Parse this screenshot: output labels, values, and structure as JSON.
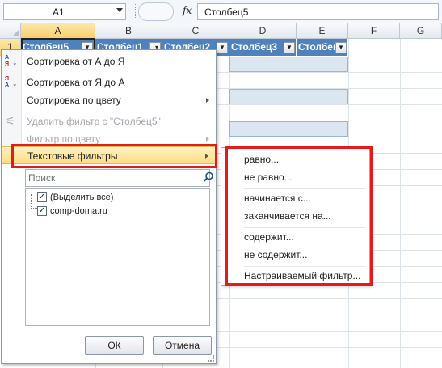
{
  "formula_bar": {
    "cell_ref": "A1",
    "fx": "fx",
    "content": "Столбец5"
  },
  "columns": [
    "A",
    "B",
    "C",
    "D",
    "E",
    "F",
    "G"
  ],
  "rows": [
    "1"
  ],
  "table_headers": [
    "Столбец5",
    "Столбец1",
    "Столбец2",
    "Столбец3",
    "Столбец"
  ],
  "colors": {
    "table_header": "#4f81bd",
    "band": "#dce6f1",
    "highlight": "#ffdc82",
    "annotation": "#e31b1b"
  },
  "menu": {
    "sort_az": "Сортировка от А до Я",
    "sort_za": "Сортировка от Я до А",
    "sort_color": "Сортировка по цвету",
    "clear_filter": "Удалить фильтр с \"Столбец5\"",
    "filter_color": "Фильтр по цвету",
    "text_filters": "Текстовые фильтры",
    "search_placeholder": "Поиск",
    "tree": [
      "(Выделить все)",
      "comp-doma.ru"
    ],
    "ok": "ОК",
    "cancel": "Отмена"
  },
  "submenu": {
    "items": [
      "равно...",
      "не равно...",
      "начинается с...",
      "заканчивается на...",
      "содержит...",
      "не содержит...",
      "Настраиваемый фильтр..."
    ]
  }
}
